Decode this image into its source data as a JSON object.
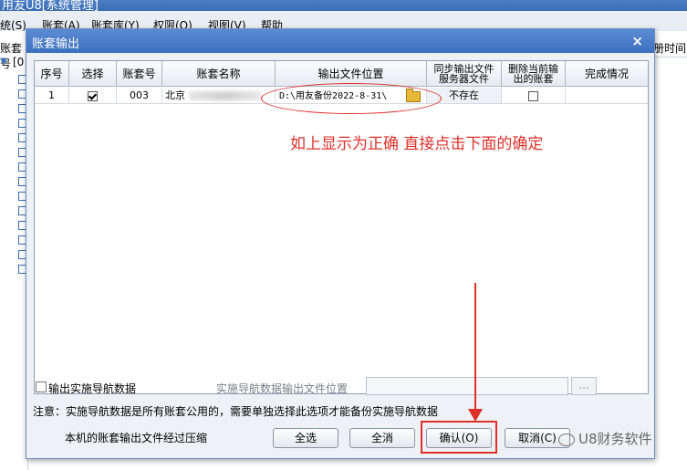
{
  "app": {
    "title": "用友U8[系统管理]",
    "menu": [
      "统(S)",
      "账套(A)",
      "账套库(Y)",
      "权限(O)",
      "视图(V)",
      "帮助"
    ]
  },
  "left_panel": {
    "label": "账套号",
    "tree_root": "[0"
  },
  "right_panel": {
    "column": "册时间"
  },
  "dialog": {
    "title": "账套输出",
    "close_glyph": "×",
    "table": {
      "headers": [
        "序号",
        "选择",
        "账套号",
        "账套名称",
        "输出文件位置",
        "同步输出文件服务器文件",
        "删除当前输出的账套",
        "完成情况"
      ],
      "header_lines": {
        "sync_1": "同步输出文件",
        "sync_2": "服务器文件",
        "delete_1": "删除当前输",
        "delete_2": "出的账套"
      },
      "rows": [
        {
          "index": "1",
          "selected": true,
          "account_no": "003",
          "account_name": "北京",
          "output_path": "D:\\用友备份2022-8-31\\",
          "sync_status": "不存在",
          "delete_current": false,
          "completion": ""
        }
      ]
    },
    "annotation": "如上显示为正确  直接点击下面的确定",
    "export_nav_label": "输出实施导航数据",
    "nav_path_label": "实施导航数据输出文件位置",
    "nav_path_value": "",
    "browse_label": "...",
    "note": "注意：实施导航数据是所有账套公用的，需要单独选择此选项才能备份实施导航数据",
    "compress_note": "本机的账套输出文件经过压缩",
    "buttons": {
      "select_all": "全选",
      "clear_all": "全消",
      "confirm": "确认(O)",
      "cancel": "取消(C)"
    }
  },
  "watermark": "U8财务软件",
  "colors": {
    "title_bar": "#3c70c0",
    "annotation_red": "#e0302a",
    "dialog_bg": "#eef1f6"
  }
}
